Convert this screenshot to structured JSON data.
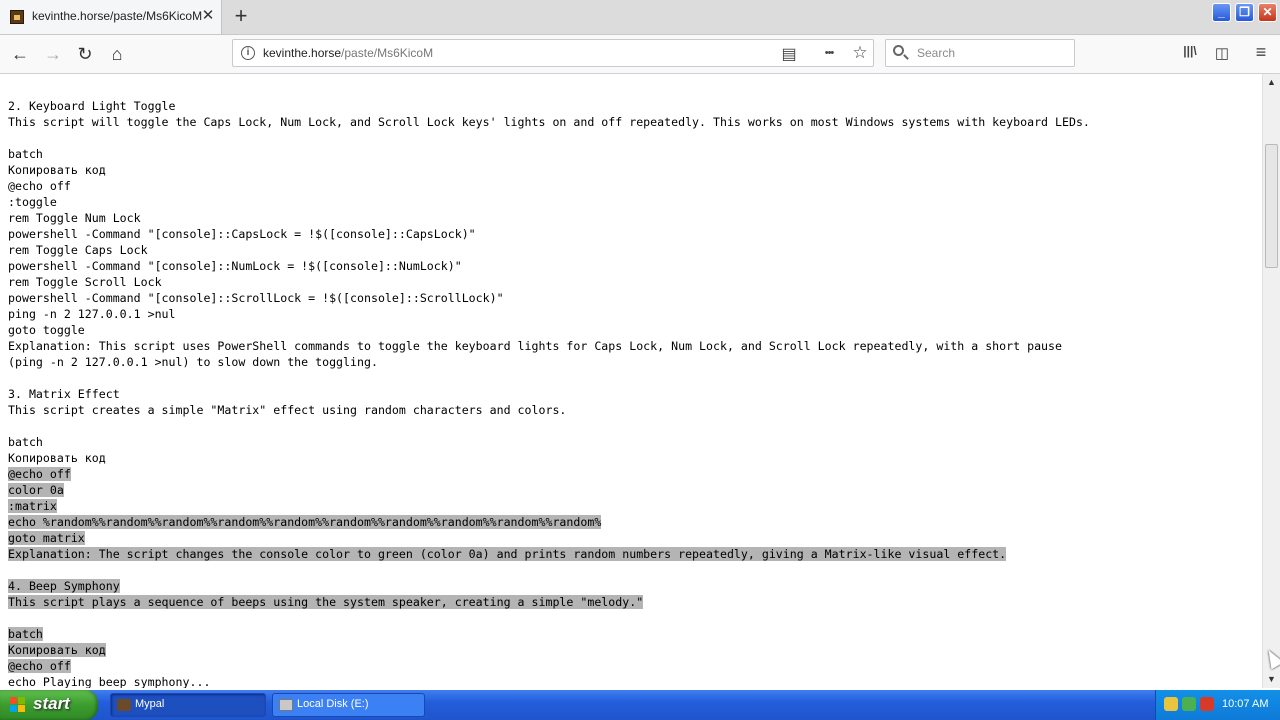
{
  "tab": {
    "title": "kevinthe.horse/paste/Ms6KicoM",
    "close": "✕",
    "new": "+"
  },
  "window": {
    "minimize": "_",
    "maximize": "❐",
    "close": "✕"
  },
  "nav": {
    "back": "←",
    "forward": "→",
    "reload": "↻",
    "home": "⌂",
    "url_host": "kevinthe.horse",
    "url_path": "/paste/Ms6KicoM",
    "reader": "▤",
    "more": "•••",
    "bookmark": "☆",
    "search_placeholder": "Search",
    "library": "|||\\",
    "sidebar": "◫",
    "menu": "≡"
  },
  "content": {
    "lines": [
      {
        "text": "",
        "hl": false
      },
      {
        "text": "",
        "hl": false
      },
      {
        "text": "2. Keyboard Light Toggle",
        "hl": false
      },
      {
        "text": "This script will toggle the Caps Lock, Num Lock, and Scroll Lock keys' lights on and off repeatedly. This works on most Windows systems with keyboard LEDs.",
        "hl": false
      },
      {
        "text": "",
        "hl": false
      },
      {
        "text": "batch",
        "hl": false
      },
      {
        "text": "Копировать код",
        "hl": false
      },
      {
        "text": "@echo off",
        "hl": false
      },
      {
        "text": ":toggle",
        "hl": false
      },
      {
        "text": "rem Toggle Num Lock",
        "hl": false
      },
      {
        "text": "powershell -Command \"[console]::CapsLock = !$([console]::CapsLock)\"",
        "hl": false
      },
      {
        "text": "rem Toggle Caps Lock",
        "hl": false
      },
      {
        "text": "powershell -Command \"[console]::NumLock = !$([console]::NumLock)\"",
        "hl": false
      },
      {
        "text": "rem Toggle Scroll Lock",
        "hl": false
      },
      {
        "text": "powershell -Command \"[console]::ScrollLock = !$([console]::ScrollLock)\"",
        "hl": false
      },
      {
        "text": "ping -n 2 127.0.0.1 >nul",
        "hl": false
      },
      {
        "text": "goto toggle",
        "hl": false
      },
      {
        "text": "Explanation: This script uses PowerShell commands to toggle the keyboard lights for Caps Lock, Num Lock, and Scroll Lock repeatedly, with a short pause",
        "hl": false
      },
      {
        "text": "(ping -n 2 127.0.0.1 >nul) to slow down the toggling.",
        "hl": false
      },
      {
        "text": "",
        "hl": false
      },
      {
        "text": "3. Matrix Effect",
        "hl": false
      },
      {
        "text": "This script creates a simple \"Matrix\" effect using random characters and colors.",
        "hl": false
      },
      {
        "text": "",
        "hl": false
      },
      {
        "text": "batch",
        "hl": false
      },
      {
        "text": "Копировать код",
        "hl": false
      },
      {
        "text": "@echo off",
        "hl": true
      },
      {
        "text": "color 0a",
        "hl": true
      },
      {
        "text": ":matrix",
        "hl": true
      },
      {
        "text": "echo %random%%random%%random%%random%%random%%random%%random%%random%%random%%random%",
        "hl": true
      },
      {
        "text": "goto matrix",
        "hl": true
      },
      {
        "text": "Explanation: The script changes the console color to green (color 0a) and prints random numbers repeatedly, giving a Matrix-like visual effect.",
        "hl": true
      },
      {
        "text": "",
        "hl": false
      },
      {
        "text": "4. Beep Symphony",
        "hl": true
      },
      {
        "text": "This script plays a sequence of beeps using the system speaker, creating a simple \"melody.\"",
        "hl": true
      },
      {
        "text": "",
        "hl": false
      },
      {
        "text": "batch",
        "hl": true
      },
      {
        "text": "Копировать код",
        "hl": true
      },
      {
        "text": "@echo off",
        "hl": true
      },
      {
        "text": "echo Playing beep symphony...",
        "hl": false
      }
    ]
  },
  "scrollbar": {
    "up": "▲",
    "down": "▼"
  },
  "taskbar": {
    "start": "start",
    "tasks": [
      "Mypal",
      "Local Disk (E:)"
    ],
    "clock": "10:07 AM"
  },
  "colors": {
    "selection": "#b4b4b4",
    "taskbar": "#245edb",
    "start": "#3c9c2f"
  }
}
